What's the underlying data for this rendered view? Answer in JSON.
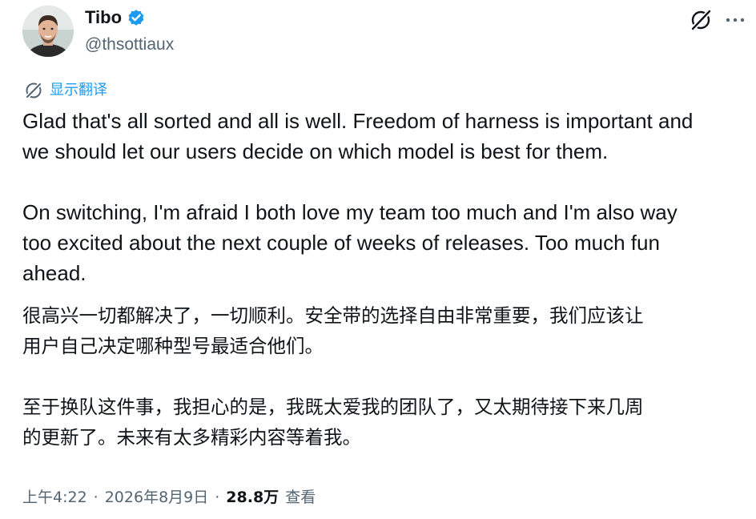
{
  "author": {
    "display_name": "Tibo",
    "handle": "@thsottiaux",
    "verified": true,
    "avatar_icon": "person-avatar"
  },
  "actions": {
    "grok_icon": "grok-icon",
    "more_icon": "more-icon"
  },
  "translate": {
    "label": "显示翻译",
    "icon": "translate-icon"
  },
  "tweet": {
    "text_en": "Glad that's all sorted and all is well. Freedom of harness is important and\nwe should let our users decide on which model is best for them.\n\nOn switching, I'm afraid I both love my team too much and I'm also way\ntoo excited about the next couple of weeks of releases. Too much fun\nahead.",
    "text_cn": "很高兴一切都解决了，一切顺利。安全带的选择自由非常重要，我们应该让\n用户自己决定哪种型号最适合他们。\n\n至于换队这件事，我担心的是，我既太爱我的团队了，又太期待接下来几周\n的更新了。未来有太多精彩内容等着我。"
  },
  "meta": {
    "time": "上午4:22",
    "separator": "·",
    "date": "2026年8月9日",
    "views_count": "28.8万",
    "views_label": "查看"
  },
  "colors": {
    "text_primary": "#0f1419",
    "text_secondary": "#536471",
    "link": "#1d9bf0",
    "verified_badge": "#1d9bf0"
  }
}
